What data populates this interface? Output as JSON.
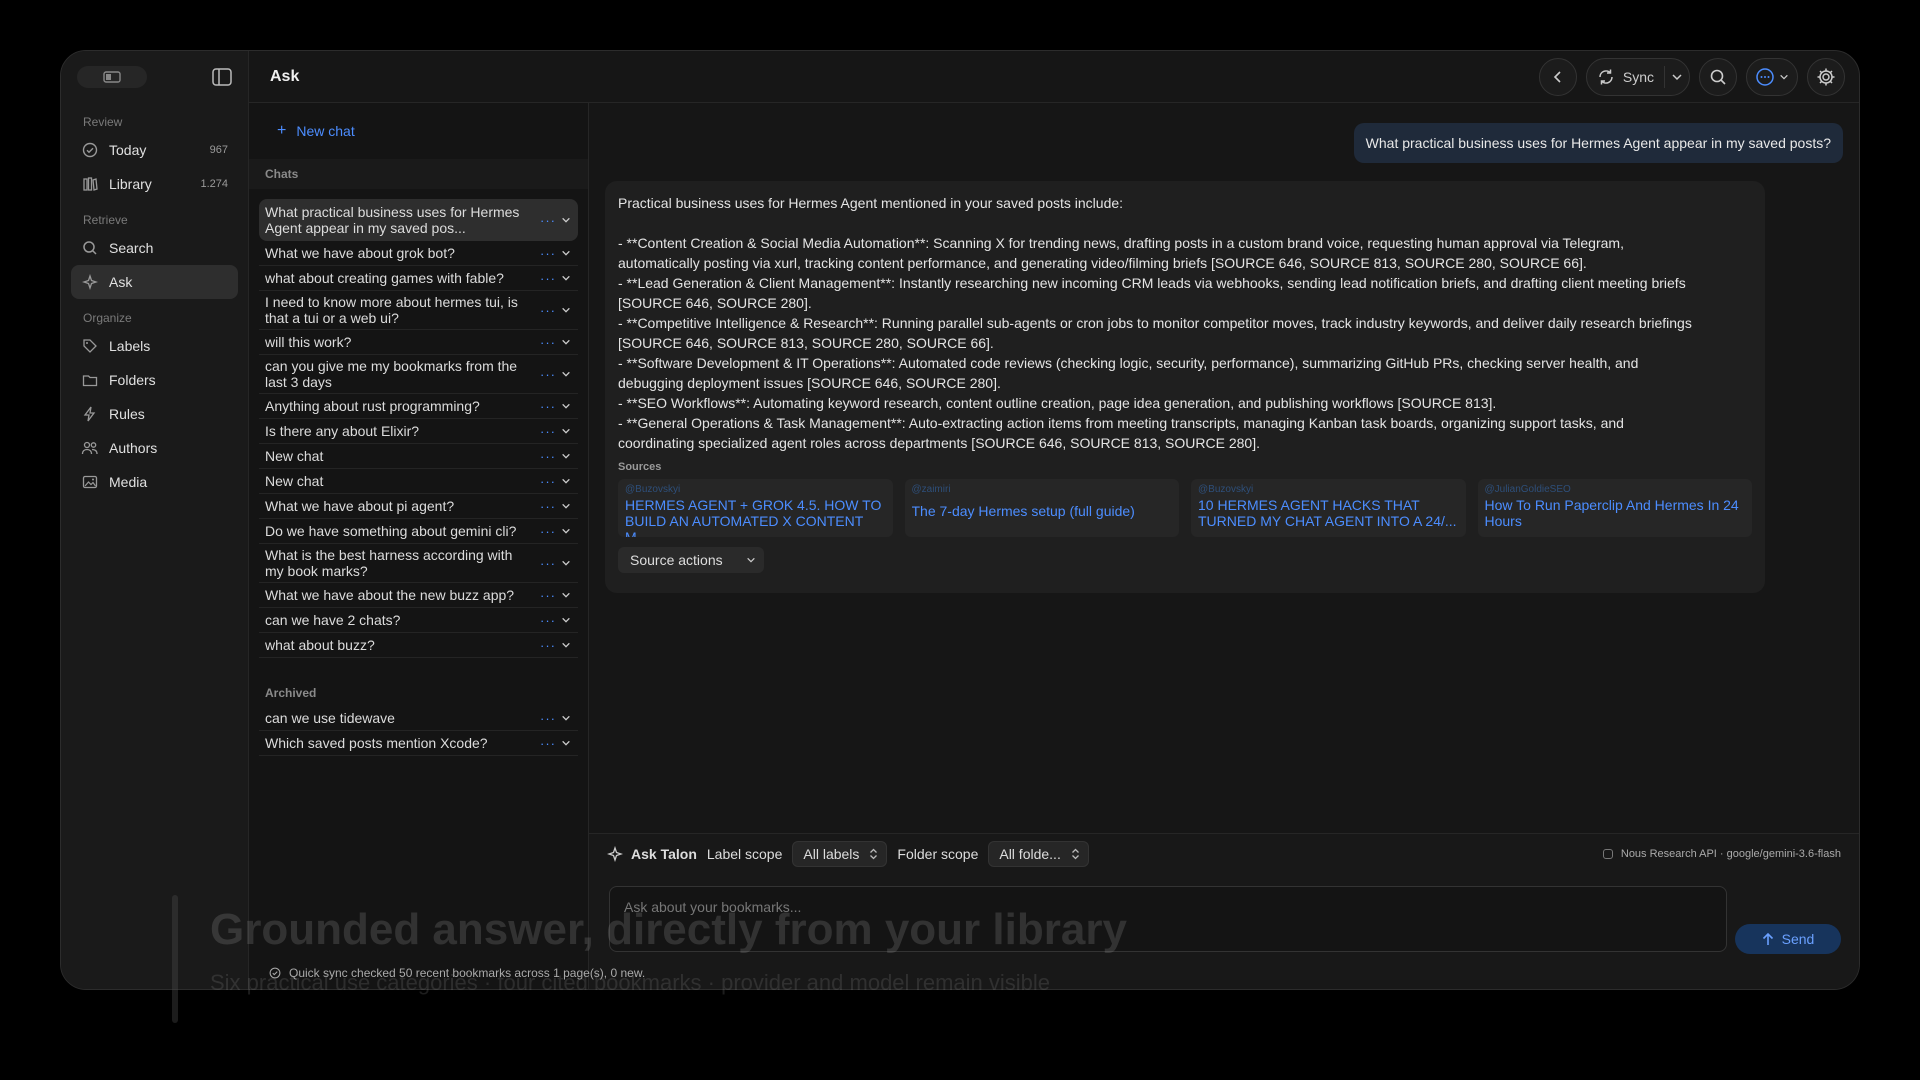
{
  "sidebar": {
    "groups": [
      {
        "label": "Review",
        "items": [
          {
            "label": "Today",
            "count": "967",
            "icon": "check-circle-icon"
          },
          {
            "label": "Library",
            "count": "1.274",
            "icon": "library-icon"
          }
        ]
      },
      {
        "label": "Retrieve",
        "items": [
          {
            "label": "Search",
            "icon": "search-icon"
          },
          {
            "label": "Ask",
            "icon": "sparkle-icon"
          }
        ]
      },
      {
        "label": "Organize",
        "items": [
          {
            "label": "Labels",
            "icon": "tag-icon"
          },
          {
            "label": "Folders",
            "icon": "folder-icon"
          },
          {
            "label": "Rules",
            "icon": "bolt-icon"
          },
          {
            "label": "Authors",
            "icon": "users-icon"
          },
          {
            "label": "Media",
            "icon": "image-icon"
          }
        ]
      }
    ]
  },
  "topbar": {
    "title": "Ask",
    "sync_label": "Sync"
  },
  "chatlist": {
    "new_chat": "New chat",
    "chats_header": "Chats",
    "chats": [
      "What practical business uses for Hermes Agent appear in my saved pos...",
      "What we have about grok bot?",
      "what about creating games with fable?",
      "I need to know more about hermes tui, is that a tui or a web ui?",
      "will this work?",
      "can you give me my bookmarks from the last 3 days",
      "Anything about rust programming?",
      "Is there any about Elixir?",
      "New chat",
      "New chat",
      "What we have about pi agent?",
      "Do we have something about gemini cli?",
      "What is the best harness according with my book marks?",
      "What we have about the new buzz app?",
      "can we have 2 chats?",
      "what about buzz?"
    ],
    "archived_header": "Archived",
    "archived": [
      "can we use tidewave",
      "Which saved posts mention Xcode?"
    ]
  },
  "conversation": {
    "question": "What practical business uses for Hermes Agent appear in my saved posts?",
    "answer_intro": "Practical business uses for Hermes Agent mentioned in your saved posts include:",
    "answer_lines": [
      "- **Content Creation & Social Media Automation**: Scanning X for trending news, drafting posts in a custom brand voice, requesting human approval via Telegram,",
      "automatically posting via xurl, tracking content performance, and generating video/filming briefs [SOURCE 646, SOURCE 813, SOURCE 280, SOURCE 66].",
      "- **Lead Generation & Client Management**: Instantly researching new incoming CRM leads via webhooks, sending lead notification briefs, and drafting client meeting briefs",
      "[SOURCE 646, SOURCE 280].",
      "- **Competitive Intelligence & Research**: Running parallel sub-agents or cron jobs to monitor competitor moves, track industry keywords, and deliver daily research briefings",
      "[SOURCE 646, SOURCE 813, SOURCE 280, SOURCE 66].",
      "- **Software Development & IT Operations**: Automated code reviews (checking logic, security, performance), summarizing GitHub PRs, checking server health, and",
      "debugging deployment issues [SOURCE 646, SOURCE 280].",
      "- **SEO Workflows**: Automating keyword research, content outline creation, page idea generation, and publishing workflows [SOURCE 813].",
      "- **General Operations & Task Management**: Auto-extracting action items from meeting transcripts, managing Kanban task boards, organizing support tasks, and",
      "coordinating specialized agent roles across departments [SOURCE 646, SOURCE 813, SOURCE 280]."
    ],
    "sources_label": "Sources",
    "sources": [
      {
        "handle": "@Buzovskyi",
        "title": "HERMES AGENT + GROK 4.5. HOW TO BUILD AN AUTOMATED X CONTENT M..."
      },
      {
        "handle": "@zaimiri",
        "title": "The 7-day Hermes setup (full guide)"
      },
      {
        "handle": "@Buzovskyi",
        "title": "10 HERMES AGENT HACKS THAT TURNED MY CHAT AGENT INTO A 24/..."
      },
      {
        "handle": "@JulianGoldieSEO",
        "title": "How To Run Paperclip And Hermes In 24 Hours"
      }
    ],
    "source_actions": "Source actions"
  },
  "composer": {
    "ask_label": "Ask Talon",
    "label_scope_label": "Label scope",
    "label_scope_value": "All labels",
    "folder_scope_label": "Folder scope",
    "folder_scope_value": "All folde...",
    "model": "Nous Research API · google/gemini-3.6-flash",
    "placeholder": "Ask about your bookmarks...",
    "send_label": "Send"
  },
  "status": "Quick sync checked 50 recent bookmarks across 1 page(s), 0 new.",
  "overlay": {
    "headline": "Grounded answer, directly from your library",
    "subline": "Six practical use categories · four cited bookmarks · provider and model remain visible"
  },
  "colors": {
    "accent": "#4c8dff",
    "bg": "#161616",
    "panel": "#1f1f1f"
  }
}
